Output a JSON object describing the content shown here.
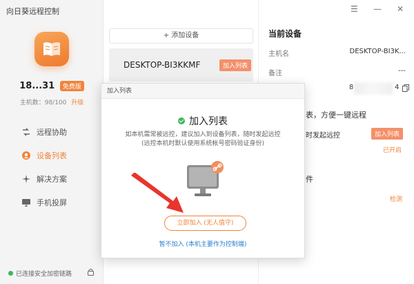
{
  "app": {
    "title": "向日葵远程控制"
  },
  "user": {
    "name": "18...31",
    "badge": "免费版",
    "host_count": "主机数：98/100",
    "upgrade": "升级"
  },
  "nav": {
    "items": [
      {
        "label": "远程协助",
        "icon": "remote-assist-icon"
      },
      {
        "label": "设备列表",
        "icon": "device-list-icon",
        "active": true
      },
      {
        "label": "解决方案",
        "icon": "solution-icon"
      },
      {
        "label": "手机投屏",
        "icon": "screen-cast-icon"
      }
    ]
  },
  "status": {
    "text": "已连接安全加密链路"
  },
  "devices": {
    "add_label": "+ 添加设备",
    "items": [
      {
        "name": "DESKTOP-BI3KKMF",
        "action": "加入列表"
      }
    ]
  },
  "current_device": {
    "title": "当前设备",
    "host_label": "主机名",
    "host_value": "DESKTOP-BI3K...",
    "note_label": "备注",
    "note_value": "---",
    "id_prefix": "8",
    "id_suffix": "4",
    "partial_1": "表，方便一键远程",
    "partial_2": "时发起远控",
    "add_btn": "加入列表",
    "enabled": "已开启",
    "partial_3": "件",
    "check": "检测"
  },
  "modal": {
    "header": "加入列表",
    "title": "加入列表",
    "desc_line1": "如本机需常被远控，建议加入到设备列表，随时发起远控",
    "desc_line2": "(远控本机时默认使用系统帐号密码验证身份)",
    "primary": "立即加入 (无人值守)",
    "secondary": "暂不加入 (本机主要作为控制端)"
  },
  "colors": {
    "accent": "#f08439",
    "link": "#2d7fd0",
    "success": "#3db85a",
    "arrow": "#e8352d"
  }
}
